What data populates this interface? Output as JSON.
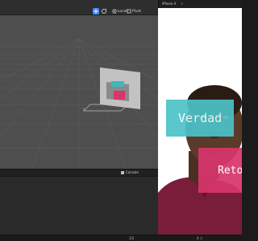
{
  "toolbar": {
    "local_label": "Local",
    "pivot_label": "Pivot"
  },
  "device": {
    "tab_label": "iPhone X",
    "close_glyph": "×"
  },
  "ar_labels": {
    "truth": "Verdad",
    "dare": "Reto"
  },
  "bottom": {
    "console_label": "Console"
  },
  "status": {
    "left_text": "1/2",
    "right_text": "4 :)"
  },
  "icons": [
    "move-tool-icon",
    "rotate-tool-icon",
    "local-icon",
    "pivot-icon",
    "console-icon",
    "face-target-icon"
  ],
  "colors": {
    "toolbar_accent": "#3a85ff",
    "label_cyan": "#4cc3c8",
    "label_pink": "#d8356c"
  }
}
